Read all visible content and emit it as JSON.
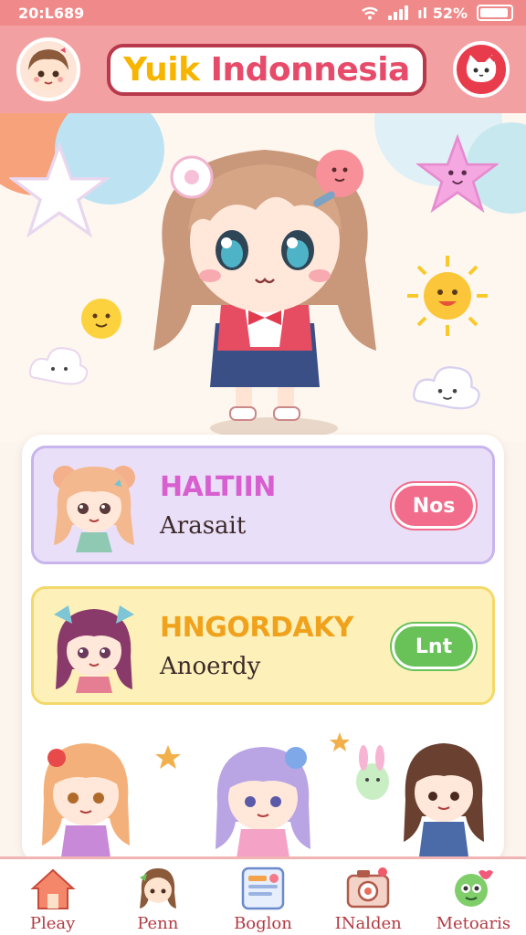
{
  "status_bar": {
    "time": "20:L689",
    "battery_text": "ıl 52%"
  },
  "header": {
    "title_part1": "Yuik",
    "title_part2": "Indonnesia"
  },
  "cards": [
    {
      "title": "HALTIIN",
      "subtitle": "Arasait",
      "button": "Nos"
    },
    {
      "title": "HNGORDAKY",
      "subtitle": "Anoerdy",
      "button": "Lnt"
    }
  ],
  "nav": [
    {
      "label": "Pleay",
      "icon": "home-icon"
    },
    {
      "label": "Penn",
      "icon": "character-icon"
    },
    {
      "label": "Boglon",
      "icon": "book-icon"
    },
    {
      "label": "INalden",
      "icon": "camera-icon"
    },
    {
      "label": "Metoaris",
      "icon": "creature-icon"
    }
  ],
  "colors": {
    "accent": "#f08a8a",
    "header": "#f3a0a2",
    "card_purple": "#eadff8",
    "card_yellow": "#fdf1b9",
    "button_pink": "#f26d8c",
    "button_green": "#68c258"
  }
}
